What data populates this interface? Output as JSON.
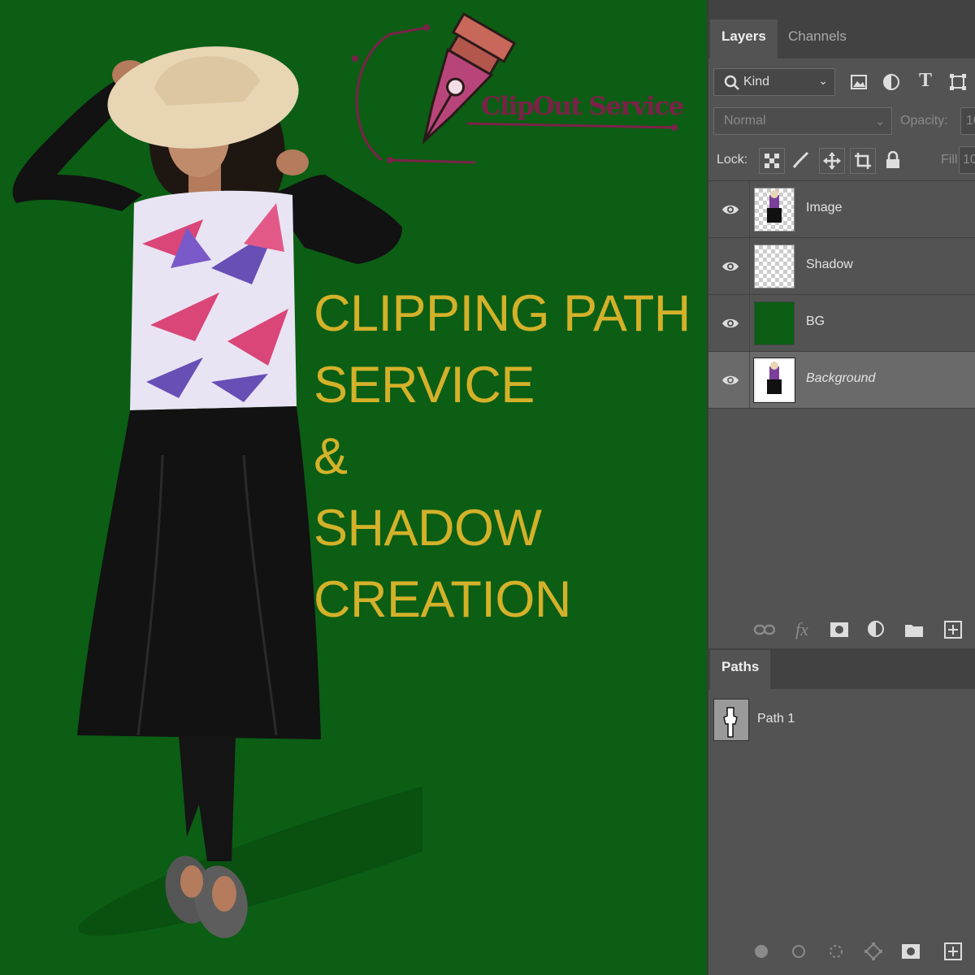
{
  "colors": {
    "background_green": "#0b5e14",
    "headline_gold": "#d4b12a",
    "logo_maroon": "#7b2148",
    "logo_nib": "#b8457a",
    "logo_cap": "#c8685a",
    "panel_bg": "#535353"
  },
  "logo": {
    "text": "ClipOut Service",
    "icon": "pen-tool-nib-icon"
  },
  "headline": {
    "lines": [
      "CLIPPING PATH",
      "SERVICE",
      "&",
      "SHADOW",
      "CREATION"
    ]
  },
  "layers_panel": {
    "tabs": [
      "Layers",
      "Channels"
    ],
    "active_tab": "Layers",
    "filter": {
      "value": "Kind",
      "icons": [
        "image-filter-icon",
        "adjustment-filter-icon",
        "type-filter-icon",
        "shape-filter-icon"
      ]
    },
    "blend_mode": "Normal",
    "opacity_label": "Opacity:",
    "opacity_value": "10",
    "lock_label": "Lock:",
    "fill_label": "Fill:",
    "fill_value": "10",
    "layers": [
      {
        "name": "Image",
        "visible": true,
        "thumb": "woman-transparent"
      },
      {
        "name": "Shadow",
        "visible": true,
        "thumb": "transparent"
      },
      {
        "name": "BG",
        "visible": true,
        "thumb": "green-fill"
      },
      {
        "name": "Background",
        "visible": true,
        "thumb": "woman-white",
        "selected": true,
        "italic": true
      }
    ],
    "footer_icons": [
      "link-icon",
      "fx-icon",
      "mask-icon",
      "adjustment-icon",
      "folder-icon",
      "new-layer-icon"
    ]
  },
  "paths_panel": {
    "tab": "Paths",
    "paths": [
      {
        "name": "Path 1"
      }
    ],
    "footer_icons": [
      "fill-path-icon",
      "stroke-path-icon",
      "load-selection-icon",
      "work-path-icon",
      "add-mask-icon",
      "new-path-icon"
    ]
  }
}
